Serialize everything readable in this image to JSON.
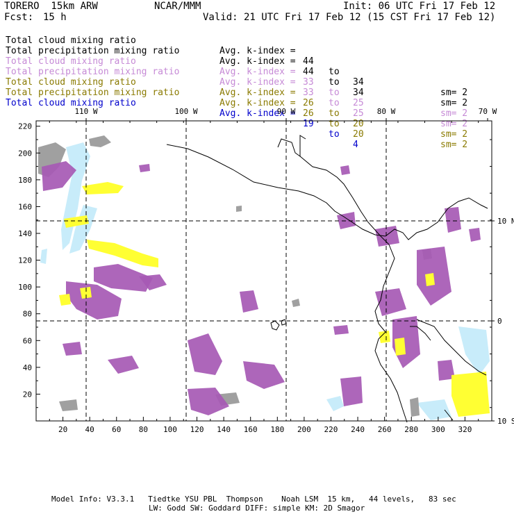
{
  "header": {
    "model": "TORERO  15km ARW",
    "org": "NCAR/MMM",
    "init": "Init: 06 UTC Fri 17 Feb 12",
    "fcst_label": "Fcst:",
    "fcst_value": "15 h",
    "valid": "Valid: 21 UTC Fri 17 Feb 12 (15 CST Fri 17 Feb 12)"
  },
  "legend": [
    {
      "field": "Total cloud mixing ratio",
      "kindex_label": "Avg. k-index =",
      "from": "44",
      "to_word": "to",
      "to": "34",
      "sm": "sm= 2",
      "color": "#000000"
    },
    {
      "field": "Total precipitation mixing ratio",
      "kindex_label": "Avg. k-index =",
      "from": "44",
      "to_word": "to",
      "to": "34",
      "sm": "sm= 2",
      "color": "#000000"
    },
    {
      "field": "Total cloud mixing ratio",
      "kindex_label": "Avg. k-index =",
      "from": "33",
      "to_word": "to",
      "to": "25",
      "sm": "sm= 2",
      "color": "#c68ad6"
    },
    {
      "field": "Total precipitation mixing ratio",
      "kindex_label": "Avg. k-index =",
      "from": "33",
      "to_word": "to",
      "to": "25",
      "sm": "sm= 2",
      "color": "#c68ad6"
    },
    {
      "field": "Total cloud mixing ratio",
      "kindex_label": "Avg. k-index =",
      "from": "26",
      "to_word": "to",
      "to": "20",
      "sm": "sm= 2",
      "color": "#8a7a00"
    },
    {
      "field": "Total precipitation mixing ratio",
      "kindex_label": "Avg. k-index =",
      "from": "26",
      "to_word": "to",
      "to": "20",
      "sm": "sm= 2",
      "color": "#8a7a00"
    },
    {
      "field": "Total cloud mixing ratio",
      "kindex_label": "Avg. k-index =",
      "from": "19",
      "to_word": "to",
      "to": "4",
      "sm": "",
      "color": "#0000cc"
    }
  ],
  "axes": {
    "lon_labels": [
      "110 W",
      "100 W",
      "90 W",
      "80 W",
      "70 W"
    ],
    "lat_labels": [
      "10 N",
      "0",
      "10 S"
    ],
    "x_ticks": [
      "20",
      "40",
      "60",
      "80",
      "100",
      "120",
      "140",
      "160",
      "180",
      "200",
      "220",
      "240",
      "260",
      "280",
      "300",
      "320"
    ],
    "y_ticks": [
      "220",
      "200",
      "180",
      "160",
      "140",
      "120",
      "100",
      "80",
      "60",
      "40",
      "20"
    ]
  },
  "colors": {
    "purple": "#a659b4",
    "gray": "#a0a0a0",
    "yellow": "#ffff33",
    "lightblue": "#c8ecfa",
    "coast": "#000000",
    "grid": "#000000"
  },
  "footer": {
    "line1": "Model Info: V3.3.1   Tiedtke YSU PBL  Thompson    Noah LSM  15 km,   44 levels,   83 sec",
    "line2": "LW: Godd SW: Goddard DIFF: simple KM: 2D Smagor"
  }
}
